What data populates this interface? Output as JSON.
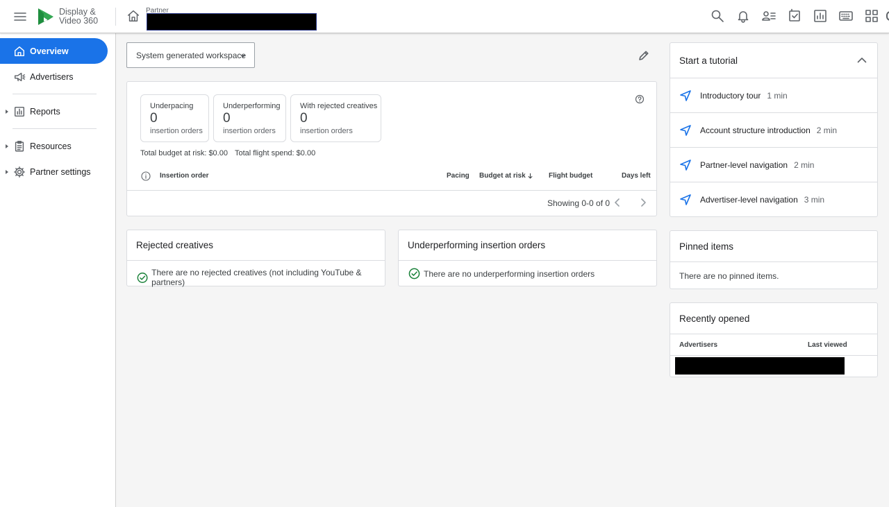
{
  "app": {
    "brand_line1": "Display &",
    "brand_line2": "Video 360",
    "partner_label": "Partner"
  },
  "colors": {
    "accent": "#1a73e8",
    "success": "#188038"
  },
  "sidebar": {
    "items": [
      {
        "label": "Overview",
        "icon": "home-icon"
      },
      {
        "label": "Advertisers",
        "icon": "megaphone-icon"
      },
      {
        "label": "Reports",
        "icon": "report-icon"
      },
      {
        "label": "Resources",
        "icon": "clipboard-icon"
      },
      {
        "label": "Partner settings",
        "icon": "gear-icon"
      }
    ]
  },
  "main": {
    "workspace": "System generated workspace",
    "summary": {
      "stats": [
        {
          "title": "Underpacing",
          "value": "0",
          "sub": "insertion orders"
        },
        {
          "title": "Underperforming",
          "value": "0",
          "sub": "insertion orders"
        },
        {
          "title": "With rejected creatives",
          "value": "0",
          "sub": "insertion orders"
        }
      ],
      "budget_at_risk": "Total budget at risk: $0.00",
      "flight_spend": "Total flight spend: $0.00",
      "columns": [
        "Insertion order",
        "Pacing",
        "Budget at risk",
        "Flight budget",
        "Days left"
      ],
      "showing": "Showing 0-0 of 0"
    },
    "rejected": {
      "title": "Rejected creatives",
      "message": "There are no rejected creatives (not including YouTube & partners)"
    },
    "underperforming": {
      "title": "Underperforming insertion orders",
      "message": "There are no underperforming insertion orders"
    }
  },
  "tutorial": {
    "title": "Start a tutorial",
    "items": [
      {
        "name": "Introductory tour",
        "duration": "1 min"
      },
      {
        "name": "Account structure introduction",
        "duration": "2 min"
      },
      {
        "name": "Partner-level navigation",
        "duration": "2 min"
      },
      {
        "name": "Advertiser-level navigation",
        "duration": "3 min"
      }
    ]
  },
  "pinned": {
    "title": "Pinned items",
    "message": "There are no pinned items."
  },
  "recent": {
    "title": "Recently opened",
    "col_advertisers": "Advertisers",
    "col_last_viewed": "Last viewed"
  }
}
